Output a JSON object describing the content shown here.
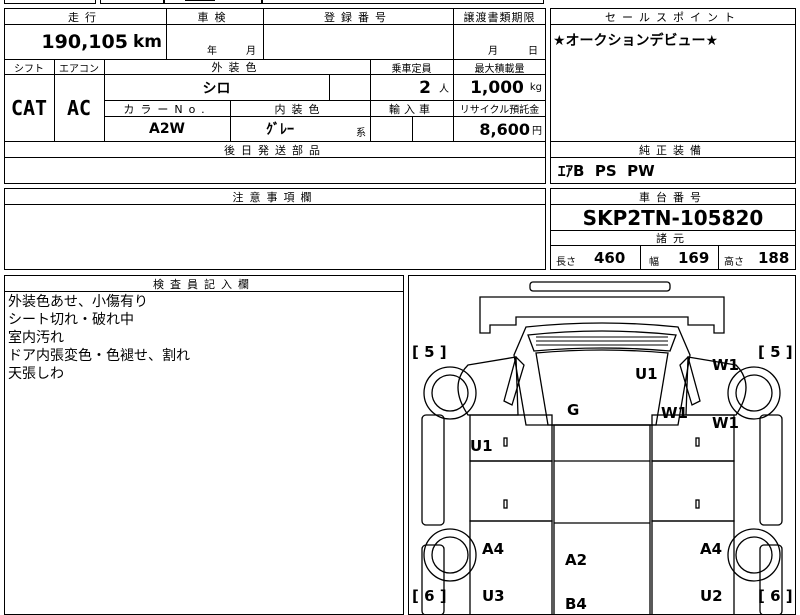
{
  "top_labels": {
    "mileage": "走行",
    "inspection": "車検",
    "registration_no": "登録番号",
    "transfer_deadline": "譲渡書類期限",
    "sales_point": "セールスポイント"
  },
  "mileage_value": "190,105",
  "mileage_unit": "km",
  "inspection_year_unit": "年",
  "inspection_month_unit": "月",
  "transfer_month_unit": "月",
  "transfer_day_unit": "日",
  "sales_point_text": "★オークションデビュー★",
  "row2_labels": {
    "shift": "シフト",
    "aircon": "エアコン",
    "exterior_color": "外装色",
    "capacity": "乗車定員",
    "max_load": "最大積載量"
  },
  "shift_value": "CAT",
  "aircon_value": "AC",
  "exterior_color_value": "シロ",
  "capacity_value": "2",
  "capacity_unit": "人",
  "max_load_value": "1,000",
  "max_load_unit": "kg",
  "row3_labels": {
    "color_no": "カラーNo.",
    "interior_color": "内装色",
    "import_car": "輸入車",
    "recycle_fee": "リサイクル預託金"
  },
  "color_no_value": "A2W",
  "interior_color_value": "ｸﾞﾚｰ",
  "interior_color_suffix": "系",
  "recycle_fee_value": "8,600",
  "recycle_fee_unit": "円",
  "later_parts_label": "後日発送部品",
  "genuine_equipment_label": "純正装備",
  "genuine_equipment_value": "ｴｱB  PS  PW",
  "caution_label": "注意事項欄",
  "chassis_no_label": "車台番号",
  "chassis_no_value": "SKP2TN-105820",
  "specs_label": "諸元",
  "specs": {
    "length_label": "長さ",
    "length_value": "460",
    "width_label": "幅",
    "width_value": "169",
    "height_label": "高さ",
    "height_value": "188"
  },
  "inspector_label": "検査員記入欄",
  "inspector_notes": [
    "外装色あせ、小傷有り",
    "シート切れ・破れ中",
    "室内汚れ",
    "ドア内張変色・色褪せ、割れ",
    "天張しわ"
  ],
  "diagram_marks": {
    "tire_front_left": "[ 5 ]",
    "tire_front_right": "[ 5 ]",
    "tire_rear_left": "[ 6 ]",
    "tire_rear_right": "[ 6 ]",
    "roof": "U1",
    "hood": "G",
    "front_right_fender": "W1",
    "pillar_right": "W1",
    "right_front_door": "W1",
    "left_front_door": "U1",
    "left_rear": "A4",
    "right_rear": "A4",
    "bed_floor": "A2",
    "left_rear_lower": "U3",
    "right_rear_lower": "U2",
    "rear_bottom": "B4"
  }
}
